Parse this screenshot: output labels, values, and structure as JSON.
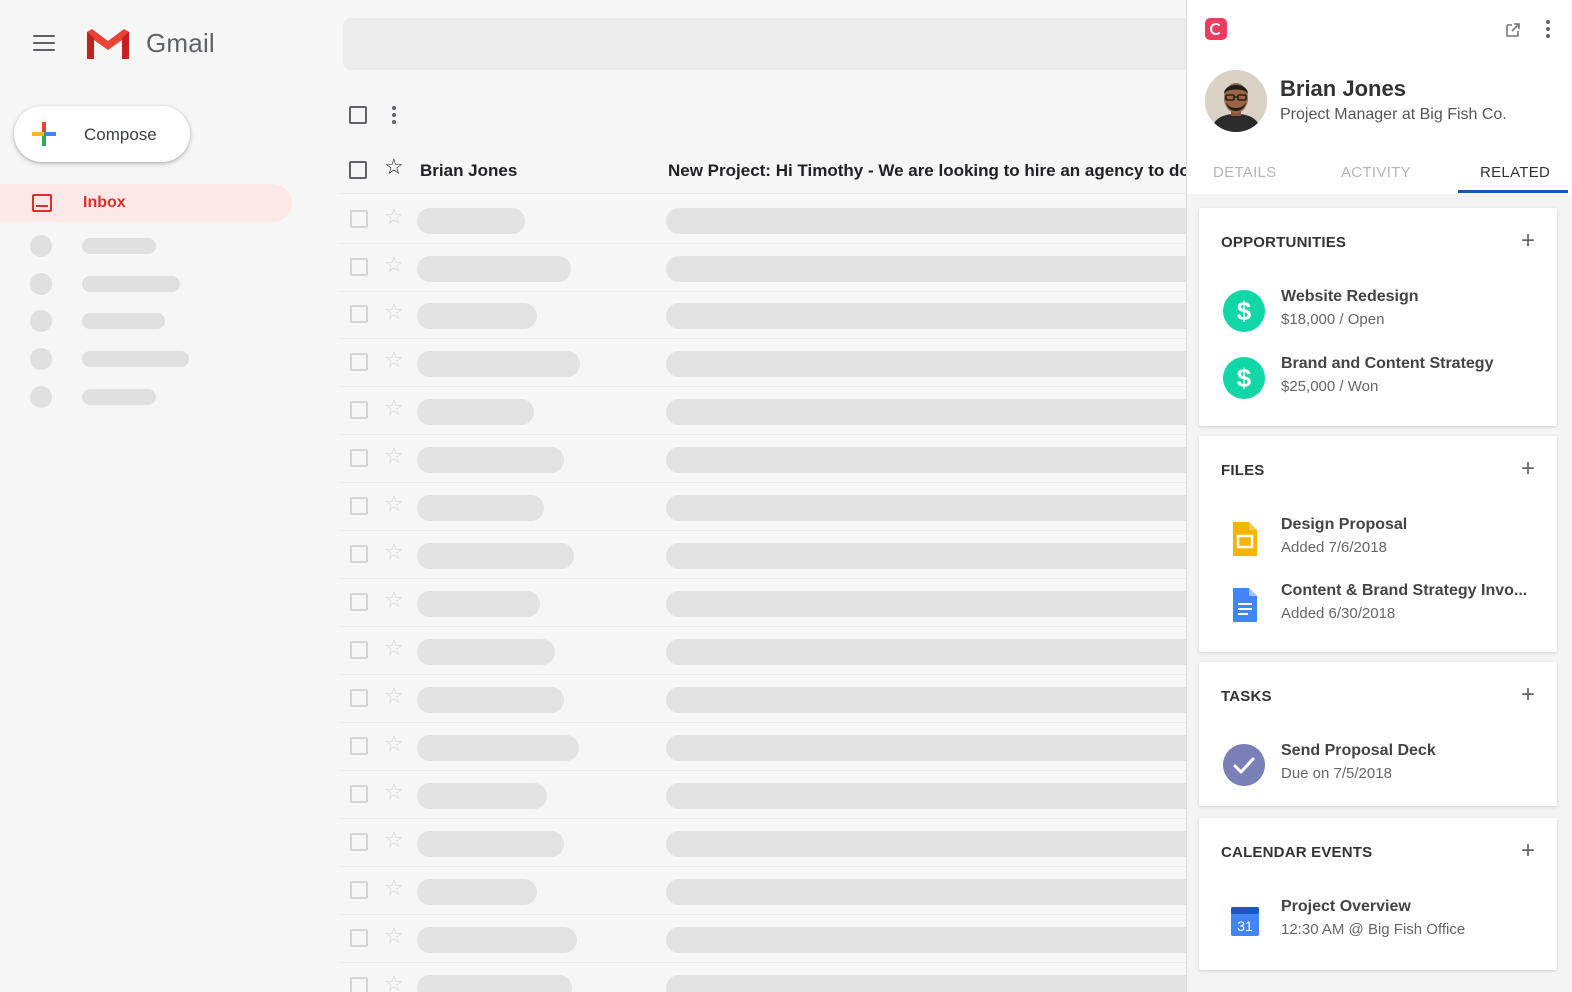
{
  "gmail": {
    "brand": "Gmail",
    "compose_label": "Compose",
    "inbox_label": "Inbox",
    "email": {
      "sender": "Brian Jones",
      "subject": "New Project: Hi Timothy - We are looking to hire an agency to do"
    }
  },
  "panel": {
    "contact": {
      "name": "Brian Jones",
      "title": "Project Manager at Big Fish Co."
    },
    "tabs": [
      "DETAILS",
      "ACTIVITY",
      "RELATED"
    ],
    "active_tab": "RELATED",
    "sections": {
      "opportunities": {
        "title": "OPPORTUNITIES",
        "items": [
          {
            "name": "Website Redesign",
            "detail": "$18,000 / Open",
            "icon": "dollar-icon"
          },
          {
            "name": "Brand and Content Strategy",
            "detail": "$25,000 / Won",
            "icon": "dollar-icon"
          }
        ]
      },
      "files": {
        "title": "FILES",
        "items": [
          {
            "name": "Design Proposal",
            "detail": "Added 7/6/2018",
            "icon": "google-slides-icon"
          },
          {
            "name": "Content & Brand Strategy Invo...",
            "detail": "Added 6/30/2018",
            "icon": "google-docs-icon"
          }
        ]
      },
      "tasks": {
        "title": "TASKS",
        "items": [
          {
            "name": "Send Proposal Deck",
            "detail": "Due on 7/5/2018",
            "icon": "check-icon"
          }
        ]
      },
      "calendar": {
        "title": "CALENDAR EVENTS",
        "items": [
          {
            "name": "Project Overview",
            "detail": "12:30 AM @ Big Fish Office",
            "icon": "calendar-icon",
            "day": "31"
          }
        ]
      }
    }
  },
  "colors": {
    "gmail_red": "#d93025",
    "copper_pink": "#ef3b5e",
    "opportunity_green": "#11d6a6",
    "task_purple": "#7b7fb8",
    "tab_underline": "#1a56a8"
  }
}
